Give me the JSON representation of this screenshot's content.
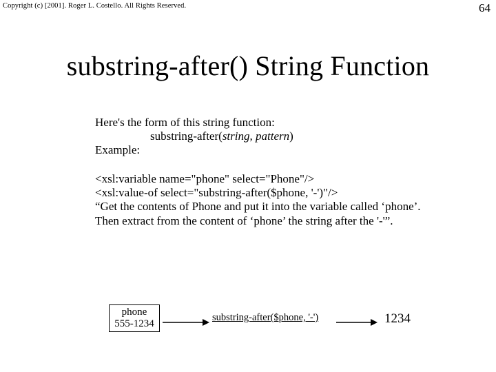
{
  "meta": {
    "copyright": "Copyright (c) [2001]. Roger L. Costello. All Rights Reserved.",
    "page_number": "64"
  },
  "title": "substring-after() String Function",
  "body": {
    "intro": "Here's the form of this string function:",
    "fn_name": "substring-after(",
    "arg1": "string",
    "sep": ", ",
    "arg2": "pattern",
    "close": ")",
    "example_label": "Example:",
    "code_line1": "<xsl:variable name=\"phone\" select=\"Phone\"/>",
    "code_line2": "<xsl:value-of select=\"substring-after($phone, '-')\"/>",
    "explanation": "“Get the contents of Phone and put it into the variable called ‘phone’.  Then extract from the content of ‘phone’ the string after the '-'”."
  },
  "diagram": {
    "box_label": "phone",
    "box_value": "555-1234",
    "fn_call": "substring-after($phone, '-')",
    "result": "1234"
  }
}
